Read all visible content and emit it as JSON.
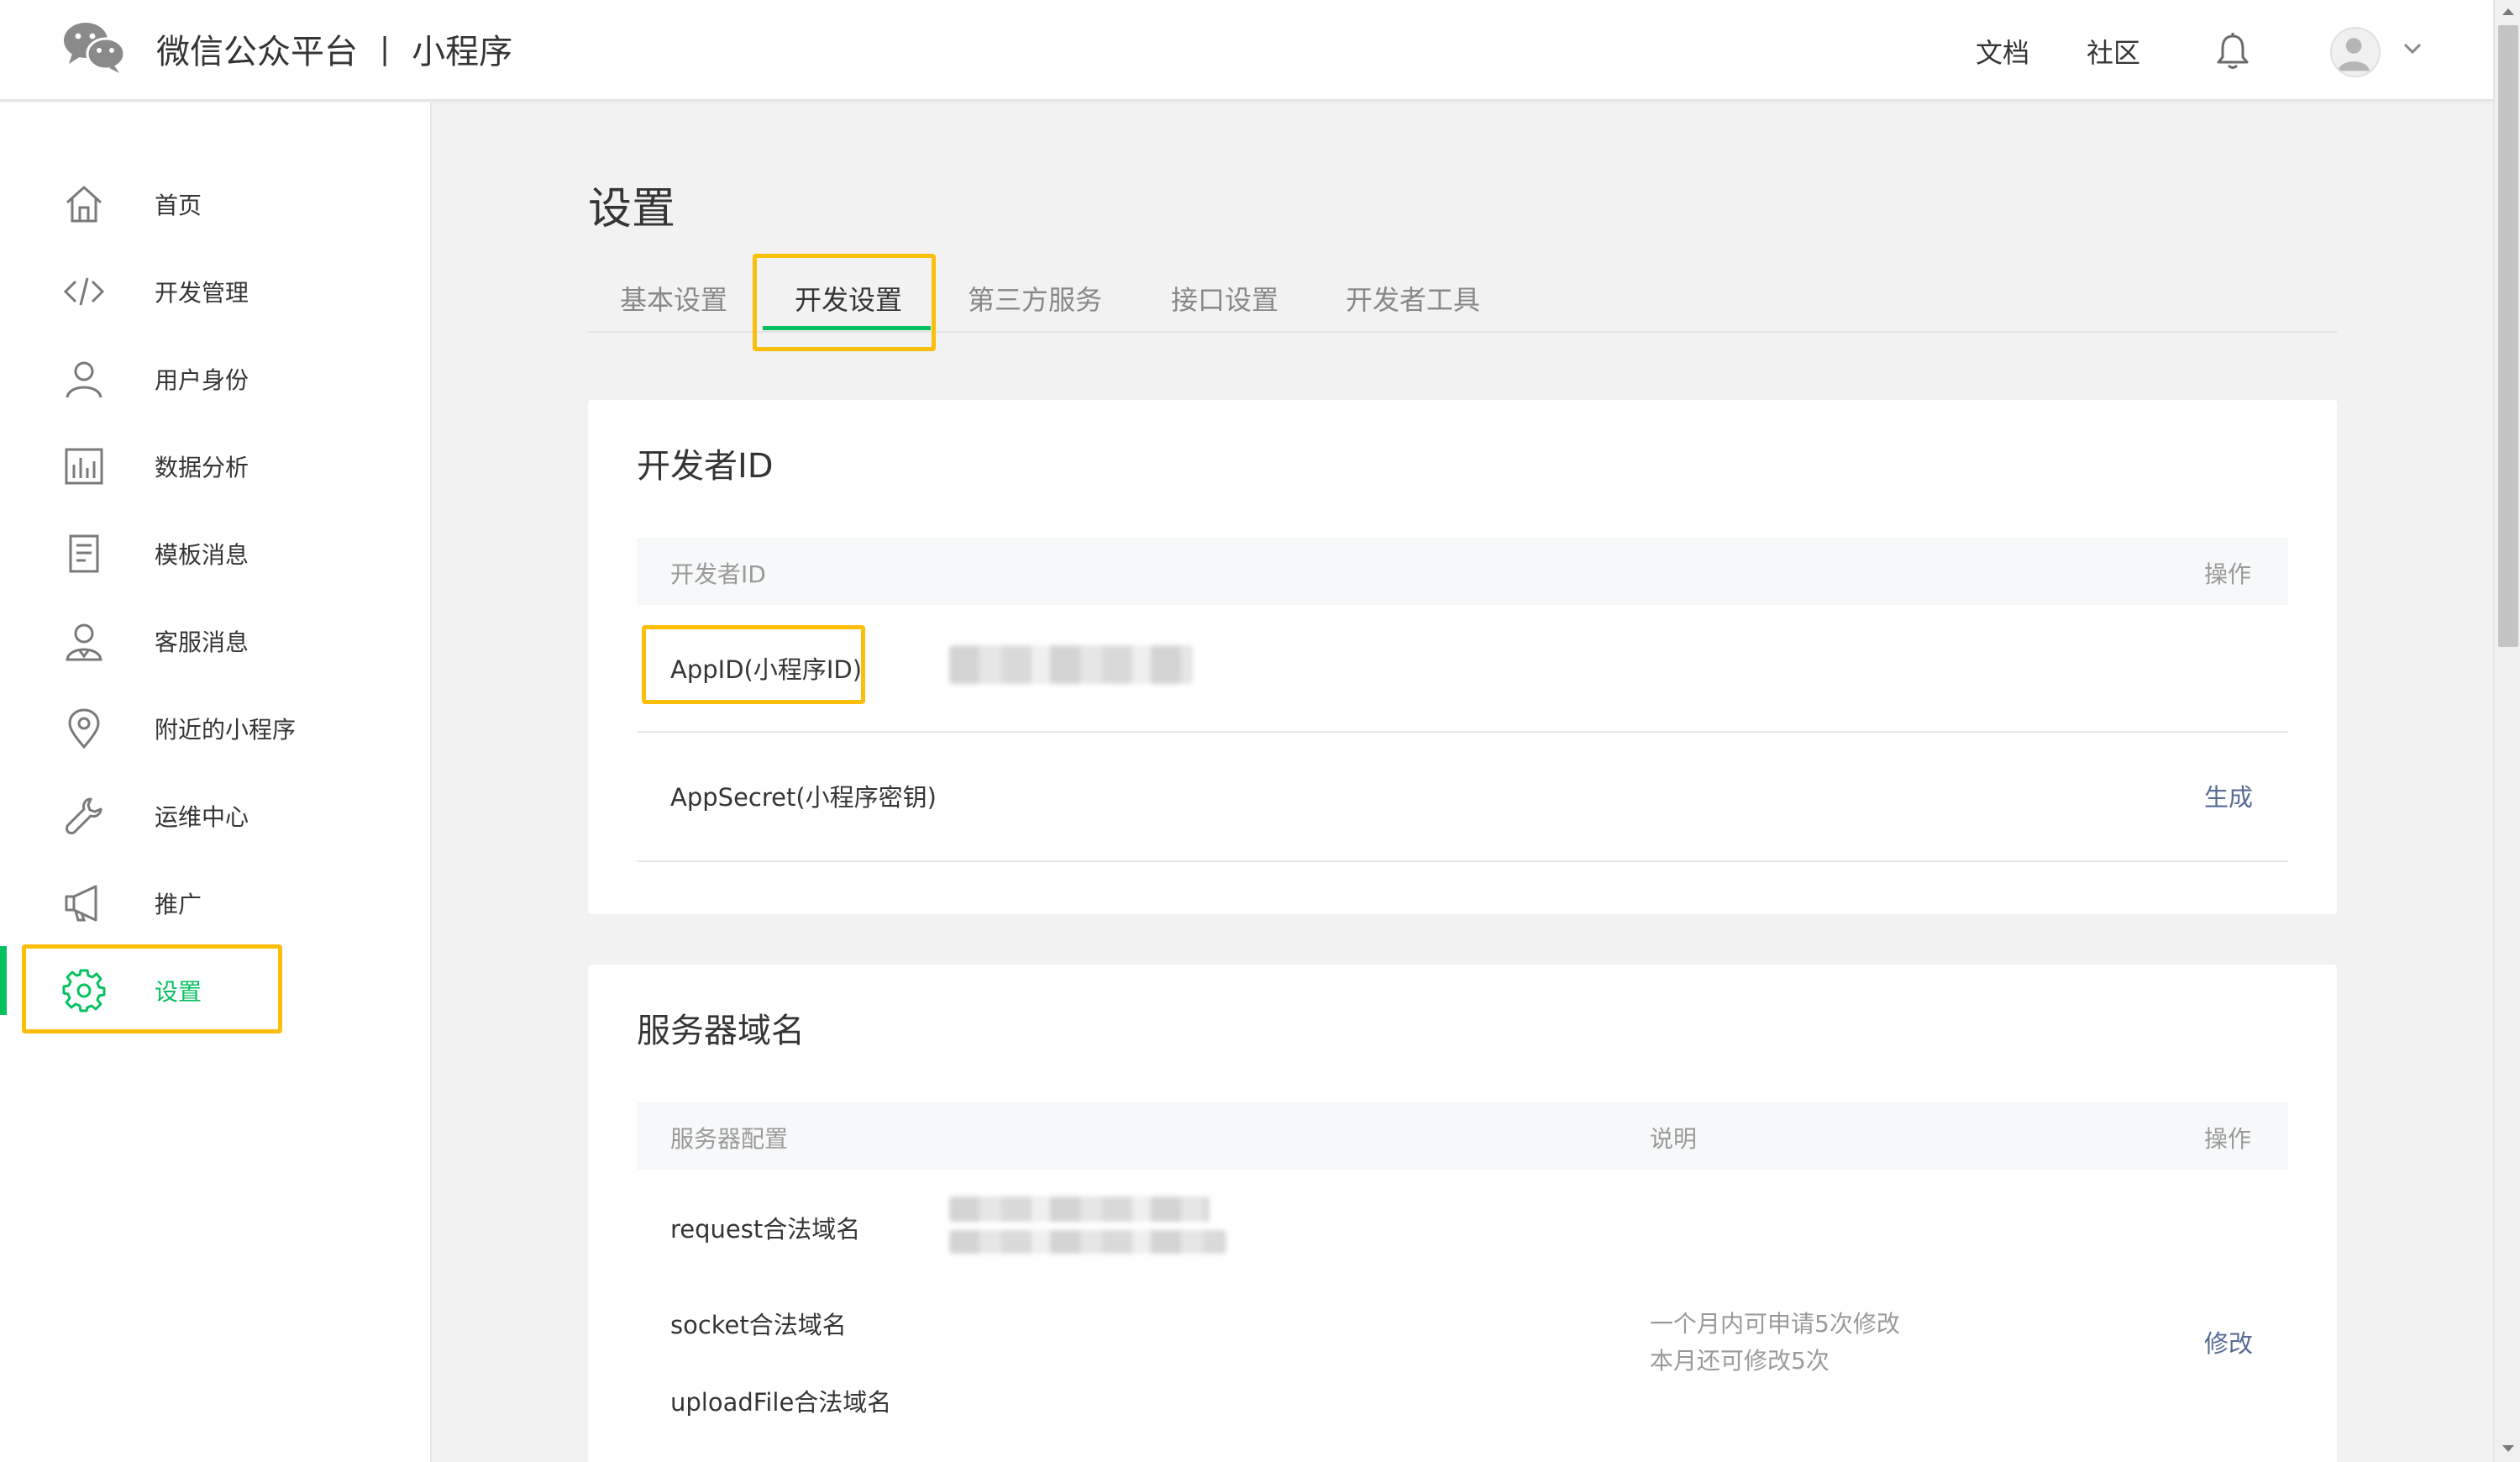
{
  "header": {
    "brand_name": "微信公众平台",
    "separator": "|",
    "product_name": "小程序",
    "links": [
      {
        "label": "文档"
      },
      {
        "label": "社区"
      }
    ]
  },
  "sidebar": {
    "items": [
      {
        "label": "首页",
        "icon": "home-icon"
      },
      {
        "label": "开发管理",
        "icon": "code-icon"
      },
      {
        "label": "用户身份",
        "icon": "user-icon"
      },
      {
        "label": "数据分析",
        "icon": "bar-chart-icon"
      },
      {
        "label": "模板消息",
        "icon": "document-icon"
      },
      {
        "label": "客服消息",
        "icon": "customer-service-icon"
      },
      {
        "label": "附近的小程序",
        "icon": "location-pin-icon"
      },
      {
        "label": "运维中心",
        "icon": "wrench-icon"
      },
      {
        "label": "推广",
        "icon": "megaphone-icon"
      },
      {
        "label": "设置",
        "icon": "gear-icon",
        "active": true
      }
    ]
  },
  "main": {
    "title": "设置",
    "tabs": [
      {
        "label": "基本设置"
      },
      {
        "label": "开发设置",
        "active": true
      },
      {
        "label": "第三方服务"
      },
      {
        "label": "接口设置"
      },
      {
        "label": "开发者工具"
      }
    ],
    "developer_id": {
      "title": "开发者ID",
      "col_id": "开发者ID",
      "col_action": "操作",
      "rows": [
        {
          "label": "AppID(小程序ID)",
          "action": ""
        },
        {
          "label": "AppSecret(小程序密钥)",
          "action": "生成"
        }
      ]
    },
    "server_domain": {
      "title": "服务器域名",
      "col_config": "服务器配置",
      "col_desc": "说明",
      "col_action": "操作",
      "rows": [
        {
          "label": "request合法域名"
        },
        {
          "label": "socket合法域名"
        },
        {
          "label": "uploadFile合法域名"
        }
      ],
      "note_line1": "一个月内可申请5次修改",
      "note_line2": "本月还可修改5次",
      "action": "修改"
    }
  },
  "colors": {
    "accent_green": "#07c160",
    "link_blue": "#576b95",
    "highlight_yellow": "#fbbf0b"
  }
}
